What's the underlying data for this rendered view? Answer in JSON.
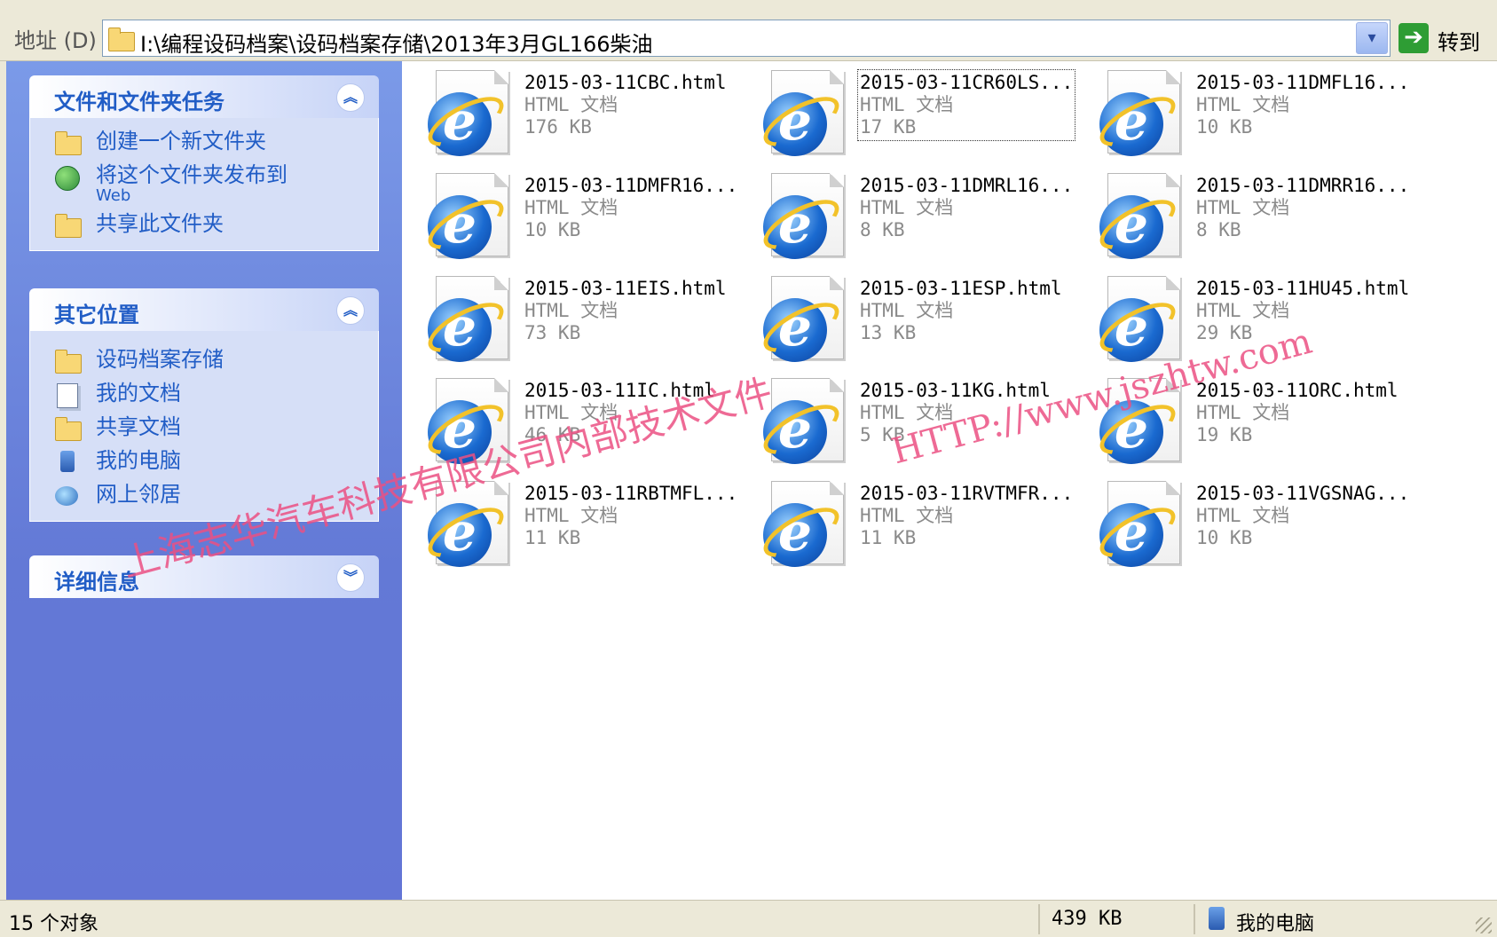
{
  "address_bar": {
    "label": "地址 (D)",
    "path": "I:\\编程设码档案\\设码档案存储\\2013年3月GL166柴油",
    "go_label": "转到"
  },
  "left_pane": {
    "file_tasks": {
      "title": "文件和文件夹任务",
      "items": [
        {
          "label": "创建一个新文件夹",
          "icon": "new-folder-icon"
        },
        {
          "label": "将这个文件夹发布到",
          "sublabel": "Web",
          "icon": "publish-web-icon"
        },
        {
          "label": "共享此文件夹",
          "icon": "share-folder-icon"
        }
      ]
    },
    "other_places": {
      "title": "其它位置",
      "items": [
        {
          "label": "设码档案存储",
          "icon": "folder-icon"
        },
        {
          "label": "我的文档",
          "icon": "my-documents-icon"
        },
        {
          "label": "共享文档",
          "icon": "folder-icon"
        },
        {
          "label": "我的电脑",
          "icon": "my-computer-icon"
        },
        {
          "label": "网上邻居",
          "icon": "network-icon"
        }
      ]
    },
    "details": {
      "title": "详细信息"
    }
  },
  "files": [
    {
      "name": "2015-03-11CBC.html",
      "type": "HTML 文档",
      "size": "176 KB"
    },
    {
      "name": "2015-03-11CR60LS...",
      "type": "HTML 文档",
      "size": "17 KB",
      "selected": true
    },
    {
      "name": "2015-03-11DMFL16...",
      "type": "HTML 文档",
      "size": "10 KB"
    },
    {
      "name": "2015-03-11DMFR16...",
      "type": "HTML 文档",
      "size": "10 KB"
    },
    {
      "name": "2015-03-11DMRL16...",
      "type": "HTML 文档",
      "size": "8 KB"
    },
    {
      "name": "2015-03-11DMRR16...",
      "type": "HTML 文档",
      "size": "8 KB"
    },
    {
      "name": "2015-03-11EIS.html",
      "type": "HTML 文档",
      "size": "73 KB"
    },
    {
      "name": "2015-03-11ESP.html",
      "type": "HTML 文档",
      "size": "13 KB"
    },
    {
      "name": "2015-03-11HU45.html",
      "type": "HTML 文档",
      "size": "29 KB"
    },
    {
      "name": "2015-03-11IC.html",
      "type": "HTML 文档",
      "size": "46 KB"
    },
    {
      "name": "2015-03-11KG.html",
      "type": "HTML 文档",
      "size": "5 KB"
    },
    {
      "name": "2015-03-11ORC.html",
      "type": "HTML 文档",
      "size": "19 KB"
    },
    {
      "name": "2015-03-11RBTMFL...",
      "type": "HTML 文档",
      "size": "11 KB"
    },
    {
      "name": "2015-03-11RVTMFR...",
      "type": "HTML 文档",
      "size": "11 KB"
    },
    {
      "name": "2015-03-11VGSNAG...",
      "type": "HTML 文档",
      "size": "10 KB"
    }
  ],
  "watermark": {
    "line1": "上海志华汽车科技有限公司内部技术文件",
    "line2": "HTTP://www.jszhtw.com"
  },
  "status_bar": {
    "object_count": "15 个对象",
    "total_size": "439 KB",
    "location": "我的电脑"
  }
}
